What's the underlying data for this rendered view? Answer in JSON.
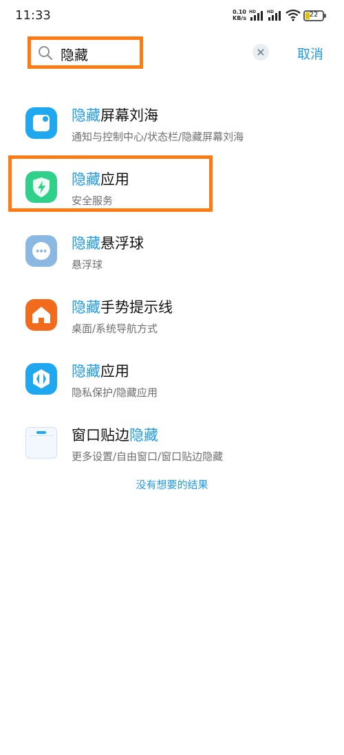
{
  "status_bar": {
    "time": "11:33",
    "net_speed_value": "0.10",
    "net_speed_unit": "KB/s",
    "signal_label": "HD",
    "battery_level": "22",
    "colors": {
      "battery": "#e7c200"
    }
  },
  "search": {
    "query": "隐藏",
    "clear_icon": "×",
    "cancel_label": "取消"
  },
  "accent_color": "#1f9be8",
  "results": [
    {
      "title_pre": "",
      "title_hl": "隐藏",
      "title_post": "屏幕刘海",
      "subtitle": "通知与控制中心/状态栏/隐藏屏幕刘海",
      "icon": "notch-icon",
      "icon_color": "#1fa8ef"
    },
    {
      "title_pre": "",
      "title_hl": "隐藏",
      "title_post": "应用",
      "subtitle": "安全服务",
      "icon": "security-shield-icon",
      "icon_color": "#2ed08a"
    },
    {
      "title_pre": "",
      "title_hl": "隐藏",
      "title_post": "悬浮球",
      "subtitle": "悬浮球",
      "icon": "floating-ball-icon",
      "icon_color": "#8bb8e2"
    },
    {
      "title_pre": "",
      "title_hl": "隐藏",
      "title_post": "手势提示线",
      "subtitle": "桌面/系统导航方式",
      "icon": "home-icon",
      "icon_color": "#f26a1b"
    },
    {
      "title_pre": "",
      "title_hl": "隐藏",
      "title_post": "应用",
      "subtitle": "隐私保护/隐藏应用",
      "icon": "privacy-icon",
      "icon_color": "#1fa8ef"
    },
    {
      "title_pre": "窗口贴边",
      "title_hl": "隐藏",
      "title_post": "",
      "subtitle": "更多设置/自由窗口/窗口贴边隐藏",
      "icon": "window-icon",
      "icon_color": "#e8f4fc"
    }
  ],
  "no_result_label": "没有想要的结果"
}
